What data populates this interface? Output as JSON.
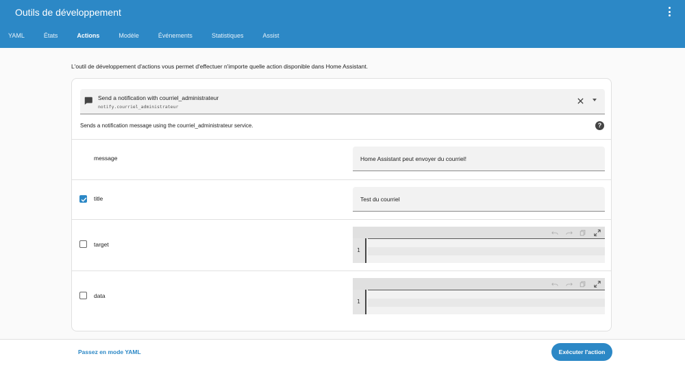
{
  "header": {
    "title": "Outils de développement",
    "menu_icon": "dots-vertical-icon",
    "background": "#2c88c6"
  },
  "tabs": [
    {
      "label": "YAML",
      "active": false
    },
    {
      "label": "États",
      "active": false
    },
    {
      "label": "Actions",
      "active": true
    },
    {
      "label": "Modèle",
      "active": false
    },
    {
      "label": "Événements",
      "active": false
    },
    {
      "label": "Statistiques",
      "active": false
    },
    {
      "label": "Assist",
      "active": false
    }
  ],
  "intro": "L'outil de développement d'actions vous permet d'effectuer n'importe quelle action disponible dans Home Assistant.",
  "action_picker": {
    "name": "Send a notification with courriel_administrateur",
    "service": "notify.courriel_administrateur",
    "icon": "message-icon"
  },
  "description": "Sends a notification message using the courriel_administrateur service.",
  "fields": {
    "message": {
      "label": "message",
      "value": "Home Assistant peut envoyer du courriel!"
    },
    "title": {
      "label": "title",
      "value": "Test du courriel",
      "checked": true
    },
    "target": {
      "label": "target",
      "checked": false,
      "line": "1"
    },
    "data": {
      "label": "data",
      "checked": false,
      "line": "1"
    }
  },
  "footer": {
    "yaml_mode_label": "Passez en mode YAML",
    "run_label": "Exécuter l'action"
  },
  "colors": {
    "accent": "#2c88c6"
  }
}
